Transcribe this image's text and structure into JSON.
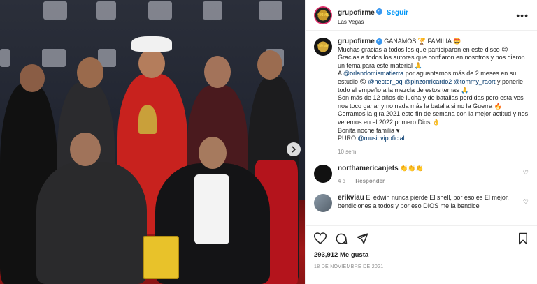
{
  "header": {
    "username": "grupofirme",
    "follow_label": "Seguir",
    "location": "Las Vegas",
    "avatar_text": "FIRME"
  },
  "caption": {
    "username": "grupofirme",
    "lines": [
      "GANAMOS 🏆 FAMILIA 🤩",
      "Muchas gracias a todos los que participaron en este disco 😊",
      "Gracias a todos los autores que confiaron en nosotros y nos dieron un tema para este material 🙏",
      "A @orlandomismatierra por aguantarnos más de 2 meses en su estudio 😝 @hector_oq @pinzonricardo2 @tommy_raort y ponerle todo el empeño a la mezcla de estos temas 🙏",
      "Son más de 12 años de lucha y de batallas perdidas pero esta ves nos toco ganar y no nada más la batalla si no la Guerra 🔥",
      "Cerramos la gira 2021 este fin de semana con la mejor actitud y nos veremos en el 2022 primero Dios 👌",
      "Bonita noche familia ♥",
      "PURO @musicvipoficial"
    ],
    "time": "10 sem"
  },
  "comments": [
    {
      "username": "northamericanjets",
      "text": "👏👏👏",
      "time": "4 d",
      "reply_label": "Responder"
    },
    {
      "username": "erikviau",
      "text": "El edwin nunca pierde El shell, por eso es El mejor, bendiciones a todos y por eso DIOS me la bendice"
    }
  ],
  "actions": {
    "like_icon": "heart-icon",
    "comment_icon": "comment-icon",
    "share_icon": "share-icon",
    "save_icon": "bookmark-icon"
  },
  "likes": "293,912 Me gusta",
  "date": "18 DE NOVIEMBRE DE 2021",
  "colors": {
    "link": "#0095f6",
    "mention": "#00376b",
    "muted": "#8e8e8e",
    "verified": "#3897f0"
  }
}
